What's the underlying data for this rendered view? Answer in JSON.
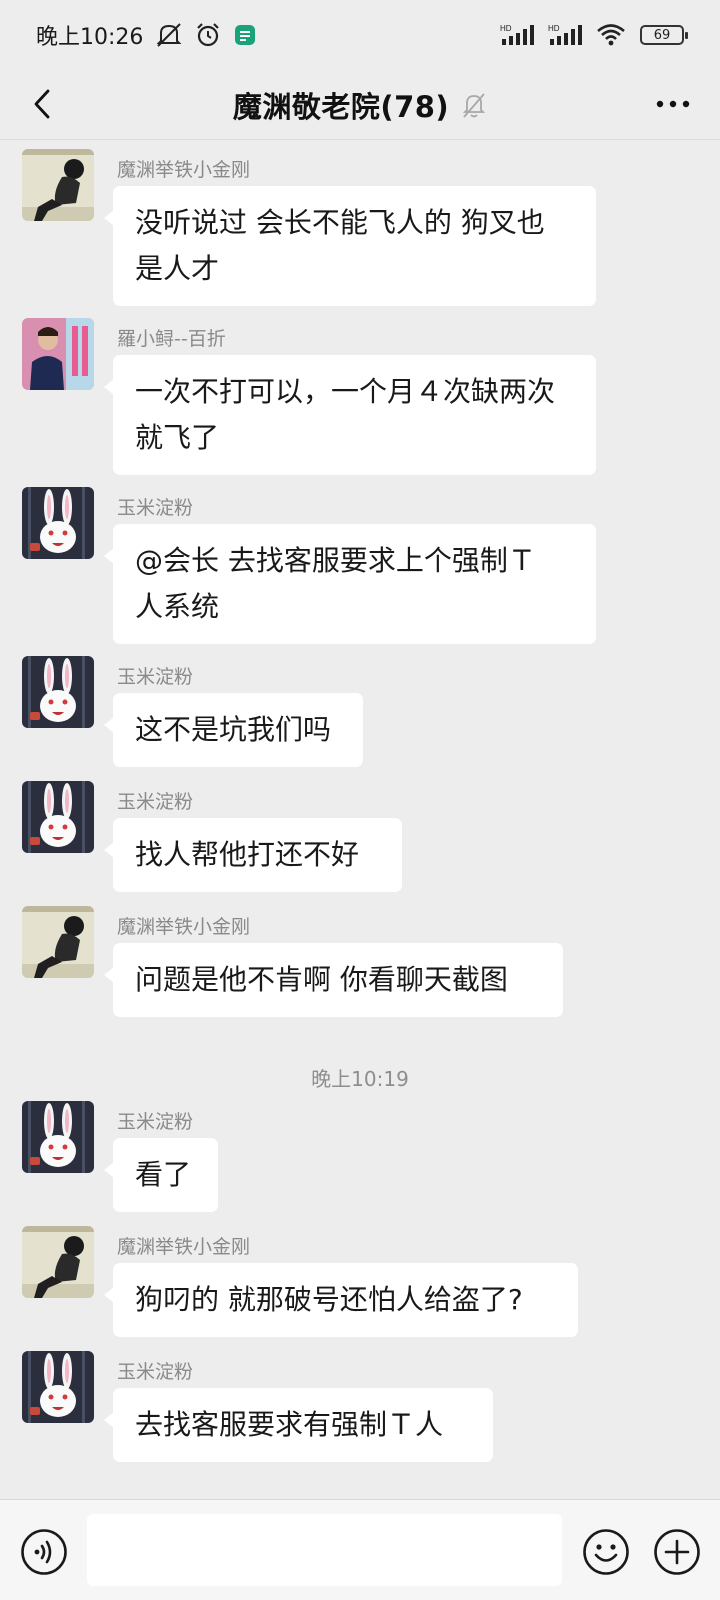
{
  "status_bar": {
    "time": "晚上10:26",
    "battery": "69",
    "signal1_label": "HD",
    "signal2_label": "HD"
  },
  "header": {
    "title": "魔渊敬老院(78)"
  },
  "time_separator": "晚上10:19",
  "messages": [
    {
      "sender": "魔渊举铁小金刚",
      "avatar": "girl-photo",
      "lines": [
        "没听说过 会长不能飞人的 狗叉也",
        "是人才"
      ]
    },
    {
      "sender": "羅小鲟--百折",
      "avatar": "man-photo",
      "lines": [
        "一次不打可以，一个月４次缺两次",
        "就飞了"
      ]
    },
    {
      "sender": "玉米淀粉",
      "avatar": "bunny",
      "lines": [
        "@会长  去找客服要求上个强制Ｔ",
        "人系统"
      ]
    },
    {
      "sender": "玉米淀粉",
      "avatar": "bunny",
      "lines": [
        "这不是坑我们吗"
      ]
    },
    {
      "sender": "玉米淀粉",
      "avatar": "bunny",
      "lines": [
        "找人帮他打还不好"
      ]
    },
    {
      "sender": "魔渊举铁小金刚",
      "avatar": "girl-photo",
      "lines": [
        "问题是他不肯啊 你看聊天截图"
      ]
    },
    {
      "sender": "玉米淀粉",
      "avatar": "bunny",
      "lines": [
        "看了"
      ]
    },
    {
      "sender": "魔渊举铁小金刚",
      "avatar": "girl-photo",
      "lines": [
        "狗叼的 就那破号还怕人给盗了?"
      ]
    },
    {
      "sender": "玉米淀粉",
      "avatar": "bunny",
      "lines": [
        "去找客服要求有强制Ｔ人"
      ]
    }
  ],
  "input": {
    "value": "",
    "placeholder": ""
  },
  "icons": {
    "back": "chevron-left-icon",
    "mute": "bell-off-icon",
    "more": "more-horizontal-icon",
    "voice": "voice-icon",
    "emoji": "emoji-icon",
    "plus": "plus-icon"
  },
  "colors": {
    "background": "#ededed",
    "bubble": "#ffffff",
    "sender_name": "#8a8a8a"
  }
}
